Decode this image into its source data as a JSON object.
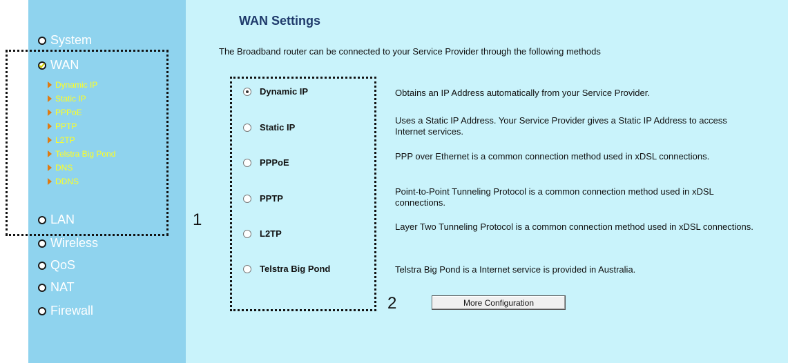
{
  "sidebar": {
    "items": [
      {
        "label": "System"
      },
      {
        "label": "WAN"
      },
      {
        "label": "LAN"
      },
      {
        "label": "Wireless"
      },
      {
        "label": "QoS"
      },
      {
        "label": "NAT"
      },
      {
        "label": "Firewall"
      }
    ],
    "wan_subitems": [
      {
        "label": "Dynamic IP"
      },
      {
        "label": "Static IP"
      },
      {
        "label": "PPPoE"
      },
      {
        "label": "PPTP"
      },
      {
        "label": "L2TP"
      },
      {
        "label": "Telstra Big Pond"
      },
      {
        "label": "DNS"
      },
      {
        "label": "DDNS"
      }
    ]
  },
  "main": {
    "title": "WAN Settings",
    "intro": "The Broadband router can be connected to your Service Provider through the following methods",
    "options": [
      {
        "label": "Dynamic IP",
        "selected": true,
        "description": "Obtains an IP Address automatically from your Service Provider."
      },
      {
        "label": "Static IP",
        "selected": false,
        "description": "Uses a Static IP Address. Your Service Provider gives a Static IP Address to access Internet services."
      },
      {
        "label": "PPPoE",
        "selected": false,
        "description": "PPP over Ethernet is a common connection method used in xDSL connections."
      },
      {
        "label": "PPTP",
        "selected": false,
        "description": "Point-to-Point Tunneling Protocol is a common connection method used in xDSL connections."
      },
      {
        "label": "L2TP",
        "selected": false,
        "description": "Layer Two Tunneling Protocol is a common connection method used in xDSL connections."
      },
      {
        "label": "Telstra Big Pond",
        "selected": false,
        "description": "Telstra Big Pond is a Internet service is provided in Australia."
      }
    ],
    "button_label": "More Configuration"
  },
  "annotations": {
    "label_1": "1",
    "label_2": "2"
  },
  "colors": {
    "sidebar": "#8fd3ee",
    "main": "#c9f3fb",
    "subitem": "#ffff22",
    "title": "#1f3a6b"
  }
}
